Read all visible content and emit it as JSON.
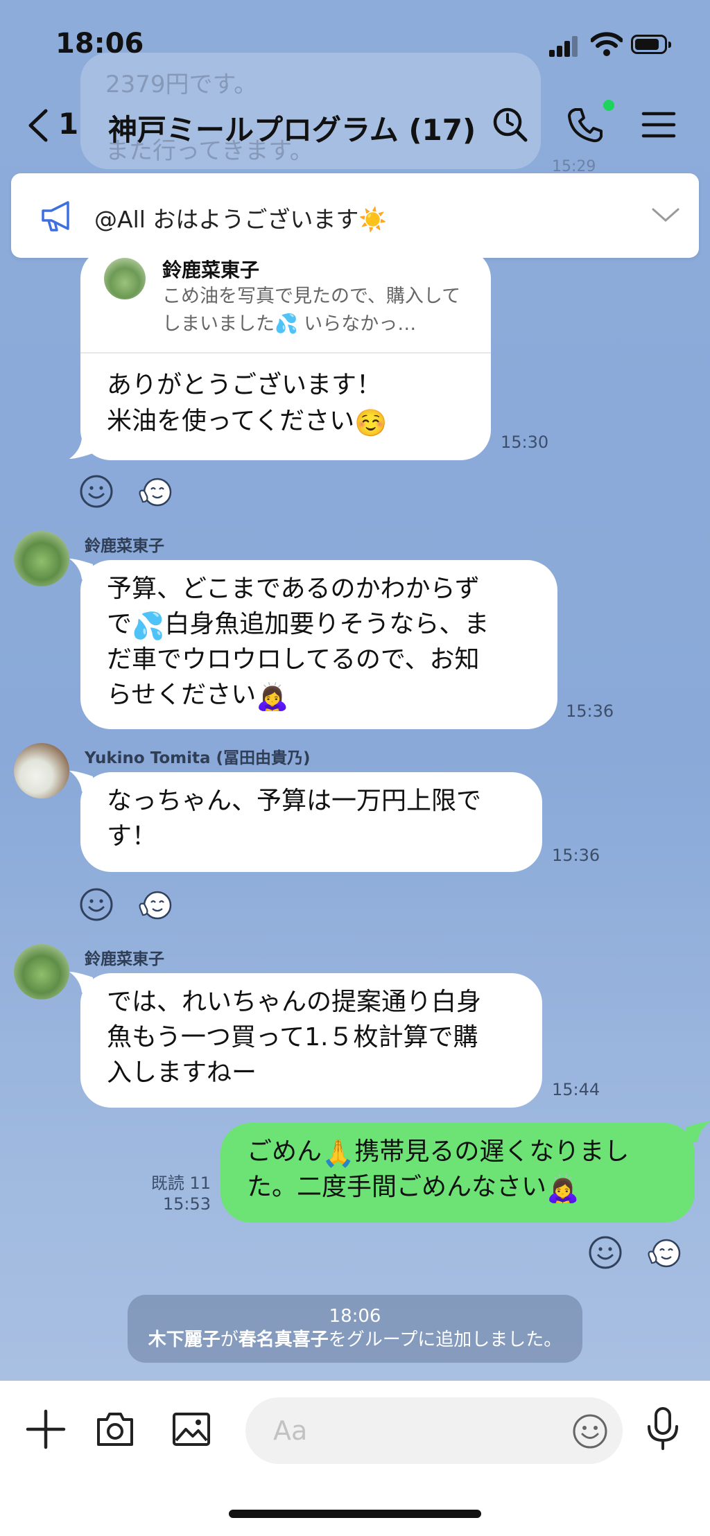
{
  "status_bar": {
    "time": "18:06"
  },
  "header": {
    "back_count": "1",
    "title": "神戸ミールプログラム (17)",
    "ghost_text_1": "2379円です。",
    "ghost_text_2": "また行ってきます。",
    "ghost_time": "15:29"
  },
  "notice": {
    "text": "@All おはようございます☀️"
  },
  "messages": {
    "reply": {
      "quoted_name": "鈴鹿菜東子",
      "quoted_text": "こめ油を写真で見たので、購入してしまいました💦 いらなかっ…",
      "line1": "ありがとうございます！",
      "line2": "米油を使ってください",
      "emoji": "☺️",
      "time": "15:30"
    },
    "m1": {
      "sender": "鈴鹿菜東子",
      "text1": "予算、どこまであるのかわからず",
      "text2a": "で",
      "emoji_a": "💦",
      "text2b": "白身魚追加要りそうなら、ま",
      "text3": "だ車でウロウロしてるので、お知",
      "text4": "らせください",
      "emoji_b": "🙇‍♀️",
      "time": "15:36"
    },
    "m2": {
      "sender": "Yukino Tomita (冨田由貴乃)",
      "text1": "なっちゃん、予算は一万円上限で",
      "text2": "す！",
      "time": "15:36"
    },
    "m3": {
      "sender": "鈴鹿菜東子",
      "text1": "では、れいちゃんの提案通り白身",
      "text2": "魚もう一つ買って1.５枚計算で購",
      "text3": "入しますねー",
      "time": "15:44"
    },
    "m4": {
      "text1a": "ごめん",
      "emoji_a": "🙏",
      "text1b": "携帯見るの遅くなりまし",
      "text2": "た。二度手間ごめんなさい",
      "emoji_b": "🙇‍♀️",
      "read": "既読 11",
      "time": "15:53"
    }
  },
  "system": {
    "time": "18:06",
    "actor": "木下麗子",
    "text_a": "が",
    "target": "春名真喜子",
    "text_b": "をグループに追加しました。"
  },
  "composer": {
    "placeholder": "Aa"
  },
  "colors": {
    "chat_bg": "#8dabd8",
    "my_bubble": "#6ce374",
    "other_bubble": "#ffffff",
    "online_dot": "#1dd45c"
  },
  "icons": [
    "back-chevron-icon",
    "search-icon",
    "phone-icon",
    "menu-icon",
    "megaphone-icon",
    "chevron-down-icon",
    "smiley-icon",
    "sticker-icon",
    "plus-icon",
    "camera-icon",
    "image-icon",
    "microphone-icon"
  ]
}
